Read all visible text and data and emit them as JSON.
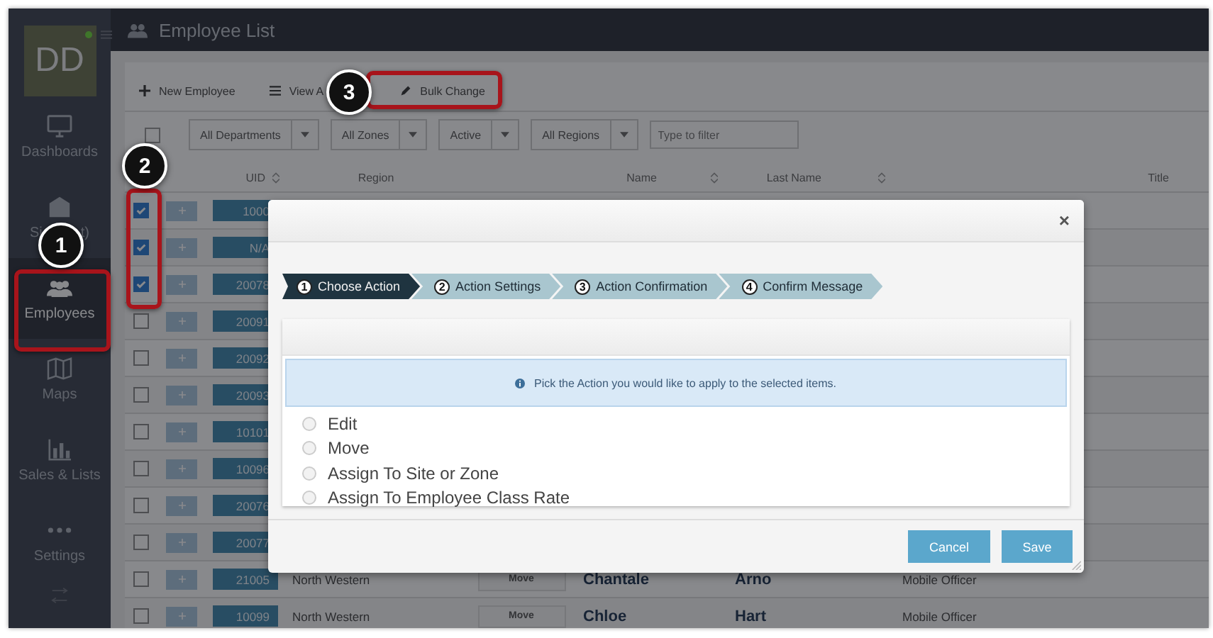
{
  "app": {
    "avatar": "DD",
    "page_title": "Employee List"
  },
  "sidebar": {
    "items": [
      {
        "kind": "monitor",
        "label": "Dashboards",
        "selected": false
      },
      {
        "kind": "sites",
        "label": "Si",
        "label_end": "t)",
        "selected": false
      },
      {
        "kind": "people",
        "label": "Employees",
        "selected": true
      },
      {
        "kind": "map",
        "label": "Maps",
        "selected": false
      },
      {
        "kind": "chart",
        "label": "Sales & Lists",
        "selected": false
      },
      {
        "kind": "dots",
        "label": "Settings",
        "selected": false
      }
    ]
  },
  "toolbar": {
    "buttons": [
      {
        "kind": "plus",
        "label": "New Employee"
      },
      {
        "kind": "list",
        "label": "View A"
      },
      {
        "kind": "pencil",
        "label": "Bulk Change"
      }
    ]
  },
  "filters": {
    "select_all": {
      "checked": false
    },
    "dropdowns": [
      "All Departments",
      "All Zones",
      "Active",
      "All Regions"
    ],
    "search": {
      "placeholder": "Type to filter"
    }
  },
  "table": {
    "columns": [
      "UID",
      "Region",
      "Name",
      "Last Name",
      "Title"
    ],
    "rows": [
      {
        "checked": true,
        "uid": "1000"
      },
      {
        "checked": true,
        "uid": "N/A"
      },
      {
        "checked": true,
        "uid": "20078"
      },
      {
        "checked": false,
        "uid": "20091"
      },
      {
        "checked": false,
        "uid": "20092"
      },
      {
        "checked": false,
        "uid": "20093"
      },
      {
        "checked": false,
        "uid": "10101"
      },
      {
        "checked": false,
        "uid": "10096"
      },
      {
        "checked": false,
        "uid": "20076"
      },
      {
        "checked": false,
        "uid": "20077"
      },
      {
        "checked": false,
        "uid": "21005",
        "region": "North Western",
        "action": "Move",
        "name": "Chantale",
        "last_name": "Arno",
        "title": "Mobile Officer"
      },
      {
        "checked": false,
        "uid": "10099",
        "region": "North Western",
        "action": "Move",
        "name": "Chloe",
        "last_name": "Hart",
        "title": "Mobile Officer"
      }
    ]
  },
  "dialog": {
    "close": "×",
    "steps": [
      {
        "number": "1",
        "label": "Choose Action",
        "selected": true
      },
      {
        "number": "2",
        "label": "Action Settings",
        "selected": false
      },
      {
        "number": "3",
        "label": "Action Confirmation",
        "selected": false
      },
      {
        "number": "4",
        "label": "Confirm Message",
        "selected": false
      }
    ],
    "info": "Pick the Action you would like to apply to the selected items.",
    "options": [
      {
        "label": "Edit",
        "selected": false
      },
      {
        "label": "Move",
        "selected": false
      },
      {
        "label": "Assign To Site or Zone",
        "selected": false
      },
      {
        "label": "Assign To Employee Class Rate",
        "selected": false
      }
    ],
    "buttons": [
      "Cancel",
      "Save"
    ]
  },
  "callouts": [
    "1",
    "2",
    "3"
  ]
}
